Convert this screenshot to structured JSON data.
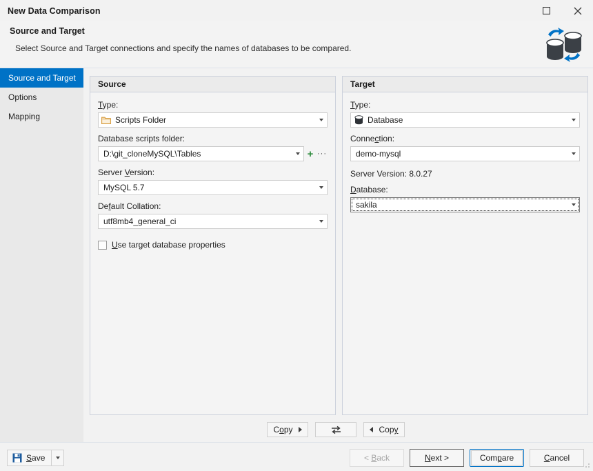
{
  "window": {
    "title": "New Data Comparison",
    "maximize_label": "Maximize",
    "close_label": "Close"
  },
  "header": {
    "title": "Source and Target",
    "subtitle": "Select Source and Target connections and specify the names of databases to be compared."
  },
  "sidebar": {
    "items": [
      {
        "label": "Source and Target",
        "active": true
      },
      {
        "label": "Options",
        "active": false
      },
      {
        "label": "Mapping",
        "active": false
      }
    ]
  },
  "source": {
    "heading": "Source",
    "type_label": "Type:",
    "type_value": "Scripts Folder",
    "folder_label": "Database scripts folder:",
    "folder_value": "D:\\git_cloneMySQL\\Tables",
    "add_label": "+",
    "browse_label": "···",
    "server_version_label": "Server Version:",
    "server_version_value": "MySQL 5.7",
    "collation_label": "Default Collation:",
    "collation_value": "utf8mb4_general_ci",
    "use_target_props_label": "Use target database properties",
    "use_target_props_checked": false
  },
  "target": {
    "heading": "Target",
    "type_label": "Type:",
    "type_value": "Database",
    "connection_label": "Connection:",
    "connection_value": "demo-mysql",
    "server_version_text": "Server Version: 8.0.27",
    "database_label": "Database:",
    "database_value": "sakila"
  },
  "copy_bar": {
    "copy_to_target_label": "Copy",
    "swap_label": "Swap",
    "copy_to_source_label": "Copy"
  },
  "footer": {
    "save_label": "Save",
    "save_menu_label": "Save options",
    "back_label": "< Back",
    "next_label": "Next >",
    "compare_label": "Compare",
    "cancel_label": "Cancel"
  },
  "colors": {
    "accent": "#0072c6",
    "window_bg": "#f2f2f2",
    "panel_border": "#ccd1dc",
    "plus_green": "#2e8b3d"
  }
}
